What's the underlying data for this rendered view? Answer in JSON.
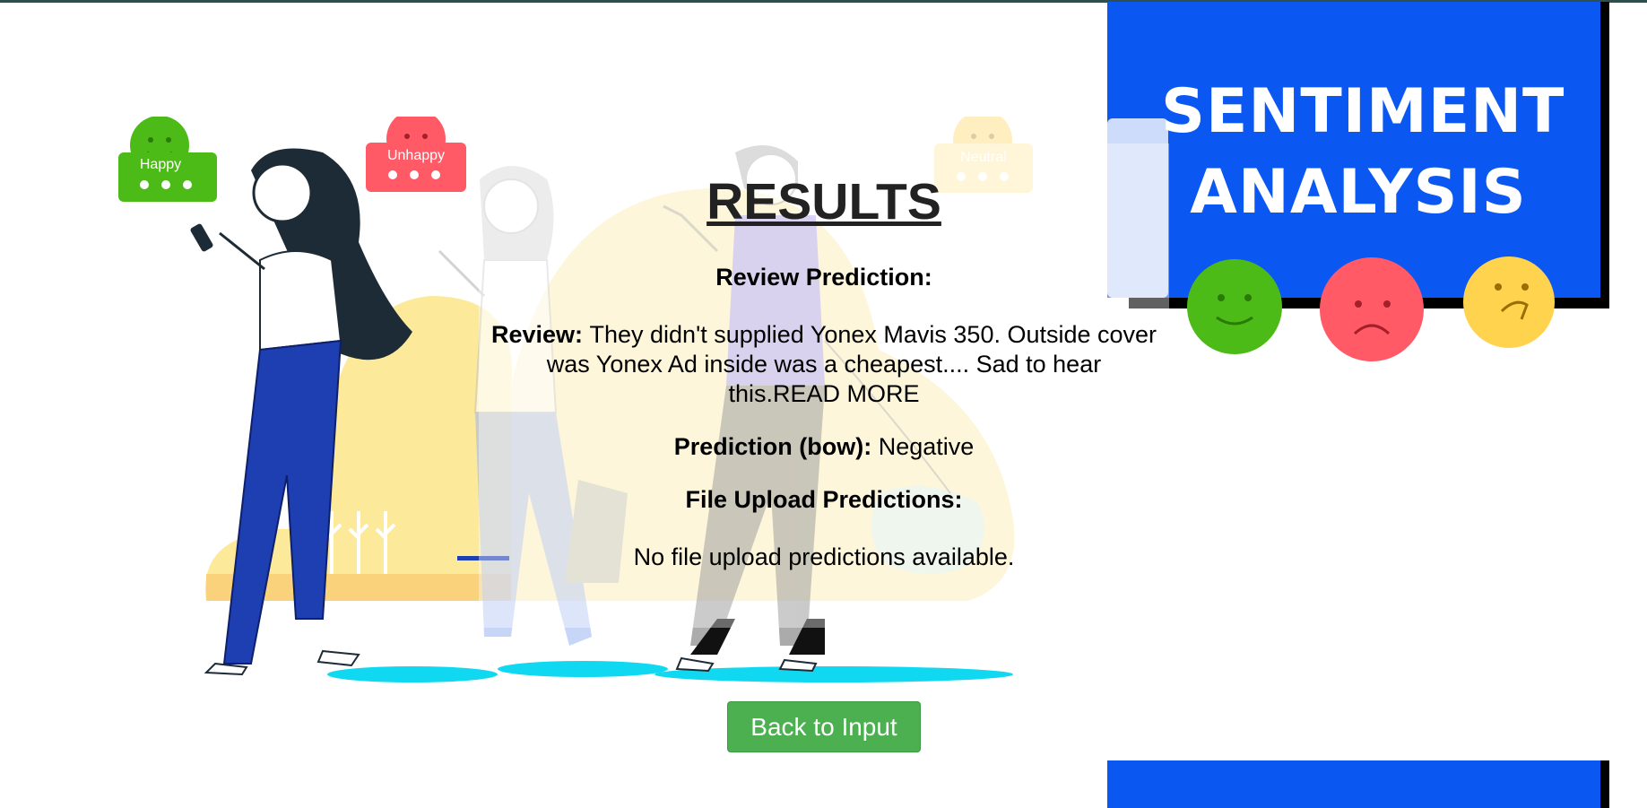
{
  "illustration": {
    "bubbles": [
      {
        "label": "Happy",
        "color": "#4cbb17"
      },
      {
        "label": "Unhappy",
        "color": "#ff5a66"
      },
      {
        "label": "Neutral",
        "color": "#ffd34d"
      }
    ]
  },
  "hero": {
    "title_line1": "SENTIMENT",
    "title_line2": "ANALYSIS",
    "background_color": "#0a57f2"
  },
  "results": {
    "title": "RESULTS",
    "review_prediction_heading": "Review Prediction:",
    "review_label": "Review:",
    "review_text": "They didn't supplied Yonex Mavis 350. Outside cover was Yonex Ad inside was a cheapest.... Sad to hear this.READ MORE",
    "prediction_label": "Prediction (bow):",
    "prediction_value": "Negative",
    "file_upload_heading": "File Upload Predictions:",
    "file_upload_empty": "No file upload predictions available."
  },
  "actions": {
    "back_label": "Back to Input",
    "button_color": "#4caf50"
  }
}
